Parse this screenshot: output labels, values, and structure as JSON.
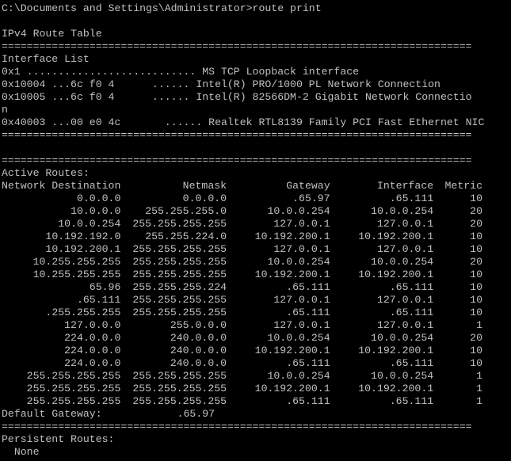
{
  "console": {
    "command_line": "C:\\Documents and Settings\\Administrator>route print",
    "table_title": "IPv4 Route Table",
    "separator": "===========================================================================",
    "interface_list_title": "Interface List",
    "interfaces": [
      "0x1 ........................... MS TCP Loopback interface",
      "0x10004 ...6c f0 4      ...... Intel(R) PRO/1000 PL Network Connection",
      "0x10005 ...6c f0 4      ...... Intel(R) 82566DM-2 Gigabit Network Connectio",
      "n",
      "0x40003 ...00 e0 4c       ...... Realtek RTL8139 Family PCI Fast Ethernet NIC"
    ],
    "active_routes_title": "Active Routes:",
    "columns": [
      "Network Destination",
      "Netmask",
      "Gateway",
      "Interface",
      "Metric"
    ],
    "routes": [
      [
        "0.0.0.0",
        "0.0.0.0",
        ".65.97",
        ".65.111",
        "10"
      ],
      [
        "10.0.0.0",
        "255.255.255.0",
        "10.0.0.254",
        "10.0.0.254",
        "20"
      ],
      [
        "10.0.0.254",
        "255.255.255.255",
        "127.0.0.1",
        "127.0.0.1",
        "20"
      ],
      [
        "10.192.192.0",
        "255.255.224.0",
        "10.192.200.1",
        "10.192.200.1",
        "10"
      ],
      [
        "10.192.200.1",
        "255.255.255.255",
        "127.0.0.1",
        "127.0.0.1",
        "10"
      ],
      [
        "10.255.255.255",
        "255.255.255.255",
        "10.0.0.254",
        "10.0.0.254",
        "20"
      ],
      [
        "10.255.255.255",
        "255.255.255.255",
        "10.192.200.1",
        "10.192.200.1",
        "10"
      ],
      [
        "65.96",
        "255.255.255.224",
        ".65.111",
        ".65.111",
        "10"
      ],
      [
        ".65.111",
        "255.255.255.255",
        "127.0.0.1",
        "127.0.0.1",
        "10"
      ],
      [
        ".255.255.255",
        "255.255.255.255",
        ".65.111",
        ".65.111",
        "10"
      ],
      [
        "127.0.0.0",
        "255.0.0.0",
        "127.0.0.1",
        "127.0.0.1",
        "1"
      ],
      [
        "224.0.0.0",
        "240.0.0.0",
        "10.0.0.254",
        "10.0.0.254",
        "20"
      ],
      [
        "224.0.0.0",
        "240.0.0.0",
        "10.192.200.1",
        "10.192.200.1",
        "10"
      ],
      [
        "224.0.0.0",
        "240.0.0.0",
        ".65.111",
        ".65.111",
        "10"
      ],
      [
        "255.255.255.255",
        "255.255.255.255",
        "10.0.0.254",
        "10.0.0.254",
        "1"
      ],
      [
        "255.255.255.255",
        "255.255.255.255",
        "10.192.200.1",
        "10.192.200.1",
        "1"
      ],
      [
        "255.255.255.255",
        "255.255.255.255",
        ".65.111",
        ".65.111",
        "1"
      ]
    ],
    "default_gateway_line": "Default Gateway:            .65.97",
    "persistent_routes_title": "Persistent Routes:",
    "persistent_routes_value": "  None",
    "colors": {
      "background": "#000000",
      "text": "#c0c0c0"
    }
  }
}
